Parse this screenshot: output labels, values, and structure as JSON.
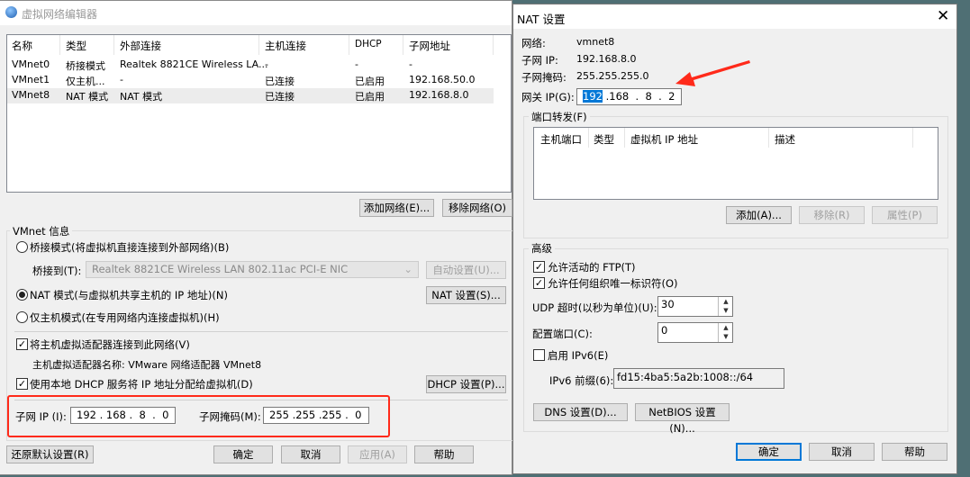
{
  "main": {
    "title": "虚拟网络编辑器",
    "columns": [
      "名称",
      "类型",
      "外部连接",
      "主机连接",
      "DHCP",
      "子网地址"
    ],
    "rows": [
      [
        "VMnet0",
        "桥接模式",
        "Realtek 8821CE Wireless LA...",
        "-",
        "-",
        "-"
      ],
      [
        "VMnet1",
        "仅主机...",
        "-",
        "已连接",
        "已启用",
        "192.168.50.0"
      ],
      [
        "VMnet8",
        "NAT 模式",
        "NAT 模式",
        "已连接",
        "已启用",
        "192.168.8.0"
      ]
    ],
    "add_network": "添加网络(E)...",
    "remove_network": "移除网络(O)",
    "group_label": "VMnet 信息",
    "bridge_radio": "桥接模式(将虚拟机直接连接到外部网络)(B)",
    "bridge_to_label": "桥接到(T):",
    "bridge_to_value": "Realtek 8821CE Wireless LAN 802.11ac PCI-E NIC",
    "auto_settings": "自动设置(U)...",
    "nat_radio": "NAT 模式(与虚拟机共享主机的 IP 地址)(N)",
    "nat_settings": "NAT 设置(S)...",
    "host_only_radio": "仅主机模式(在专用网络内连接虚拟机)(H)",
    "connect_adapter": "将主机虚拟适配器连接到此网络(V)",
    "adapter_name": "主机虚拟适配器名称: VMware 网络适配器 VMnet8",
    "use_dhcp": "使用本地 DHCP 服务将 IP 地址分配给虚拟机(D)",
    "dhcp_settings": "DHCP 设置(P)...",
    "subnet_ip_label": "子网 IP (I):",
    "subnet_ip": [
      "192",
      "168",
      "8",
      "0"
    ],
    "subnet_mask_label": "子网掩码(M):",
    "subnet_mask": [
      "255",
      "255",
      "255",
      "0"
    ],
    "restore": "还原默认设置(R)",
    "ok": "确定",
    "cancel": "取消",
    "apply": "应用(A)",
    "help": "帮助"
  },
  "nat": {
    "title": "NAT 设置",
    "network_label": "网络:",
    "network": "vmnet8",
    "subnet_ip_label": "子网 IP:",
    "subnet_ip": "192.168.8.0",
    "subnet_mask_label": "子网掩码:",
    "subnet_mask": "255.255.255.0",
    "gateway_label": "网关 IP(G):",
    "gateway": [
      "192",
      "168",
      "8",
      "2"
    ],
    "port_forward_label": "端口转发(F)",
    "pf_columns": [
      "主机端口",
      "类型",
      "虚拟机 IP 地址",
      "描述"
    ],
    "add": "添加(A)...",
    "remove": "移除(R)",
    "properties": "属性(P)",
    "advanced_label": "高级",
    "allow_ftp": "允许活动的 FTP(T)",
    "allow_oui": "允许任何组织唯一标识符(O)",
    "udp_label": "UDP 超时(以秒为单位)(U):",
    "udp_value": "30",
    "config_port_label": "配置端口(C):",
    "config_port_value": "0",
    "enable_ipv6": "启用 IPv6(E)",
    "ipv6_prefix_label": "IPv6 前缀(6):",
    "ipv6_prefix": "fd15:4ba5:5a2b:1008::/64",
    "dns": "DNS 设置(D)...",
    "netbios": "NetBIOS 设置(N)...",
    "ok": "确定",
    "cancel": "取消",
    "help": "帮助"
  },
  "colors": {
    "highlight": "#0078d7",
    "annotation": "#ff2a1a"
  }
}
